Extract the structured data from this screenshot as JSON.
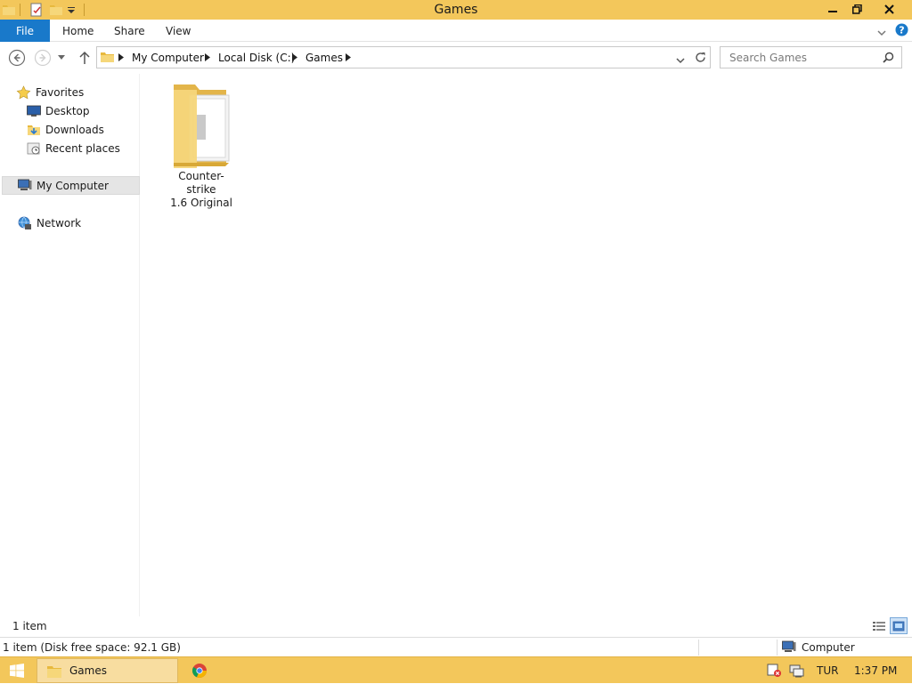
{
  "window": {
    "title": "Games",
    "minimize_label": "▬",
    "maximize_label": "❐",
    "close_label": "✕"
  },
  "ribbon": {
    "file_tab": "File",
    "tabs": [
      "Home",
      "Share",
      "View"
    ]
  },
  "address": {
    "crumbs": [
      "My Computer",
      "Local Disk (C:)",
      "Games"
    ]
  },
  "search": {
    "placeholder": "Search Games"
  },
  "nav_pane": {
    "favorites": "Favorites",
    "favorites_items": [
      "Desktop",
      "Downloads",
      "Recent places"
    ],
    "my_computer": "My Computer",
    "network": "Network"
  },
  "content": {
    "items": [
      {
        "name": "Counter-strike 1.6 Original",
        "line1": "Counter-strike",
        "line2": "1.6 Original",
        "icon": "folder-icon"
      }
    ]
  },
  "status": {
    "item_count": "1 item",
    "disk_info": "1 item (Disk free space: 92.1 GB)",
    "zone": "Computer"
  },
  "taskbar": {
    "task_label": "Games",
    "language": "TUR",
    "clock": "1:37 PM"
  },
  "colors": {
    "titlebar": "#f3c75b",
    "file_tab": "#1979ca",
    "taskbar": "#f3c75b"
  }
}
